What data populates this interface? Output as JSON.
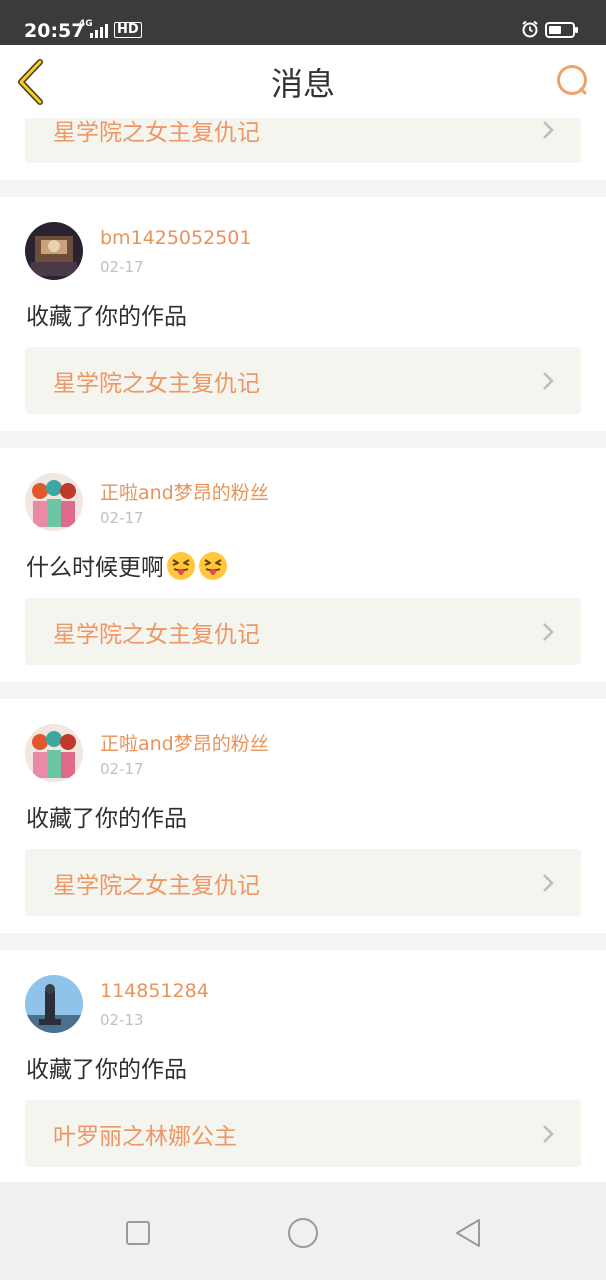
{
  "status_bar": {
    "time": "20:57",
    "network": "4G",
    "hd": "HD",
    "battery_level": 0.55
  },
  "header": {
    "title": "消息",
    "back_icon": "back-chevron-icon",
    "search_icon": "search-icon"
  },
  "colors": {
    "accent": "#e8935a",
    "link_bg": "#f5f5ef",
    "date": "#c0c0c0",
    "text": "#2f2f2f"
  },
  "messages": [
    {
      "work_title": "星学院之女主复仇记"
    },
    {
      "username": "bm1425052501",
      "date": "02-17",
      "text": "收藏了你的作品",
      "work_title": "星学院之女主复仇记"
    },
    {
      "username": "正啦and梦昂的粉丝",
      "date": "02-17",
      "text": "什么时候更啊",
      "emoji": "squinting-face-with-tongue",
      "emoji_count": 2,
      "work_title": "星学院之女主复仇记"
    },
    {
      "username": "正啦and梦昂的粉丝",
      "date": "02-17",
      "text": "收藏了你的作品",
      "work_title": "星学院之女主复仇记"
    },
    {
      "username": "114851284",
      "date": "02-13",
      "text": "收藏了你的作品",
      "work_title": "叶罗丽之林娜公主"
    }
  ],
  "nav_bar": {
    "recent_icon": "square-icon",
    "home_icon": "circle-icon",
    "back_icon": "triangle-back-icon"
  }
}
